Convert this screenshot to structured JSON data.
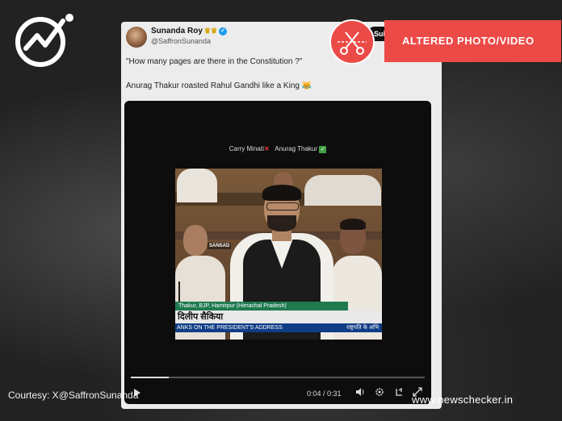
{
  "tweet": {
    "author_name": "Sunanda Roy",
    "author_handle": "@SaffronSunanda",
    "subscribe_label": "Subscribe",
    "line1": "\"How many pages are there in the Constitution ?\"",
    "line2": "Anurag Thakur roasted Rahul Gandhi like a King 😹"
  },
  "video": {
    "caption_left": "Carry Minati",
    "caption_right": "Anurag Thakur",
    "watermark": "SANSAD",
    "lower_third_1": "Thakur, BJP, Hamirpur (Himachal Pradesh)",
    "lower_third_2": "दिलीप सैकिया",
    "lower_third_3": "ANKS ON THE PRESIDENT'S ADDRESS",
    "lower_third_3_right": "राष्ट्रपति के अभि",
    "time_display": "0:04 / 0:31",
    "progress": 0.13
  },
  "badge": {
    "label": "ALTERED PHOTO/VIDEO",
    "icon": "scissors-icon"
  },
  "footer": {
    "courtesy": "Courtesy: X@SaffronSunanda",
    "site": "www.newschecker.in"
  },
  "colors": {
    "badge_red": "#ec4a47",
    "background": "#1e1e1e"
  }
}
